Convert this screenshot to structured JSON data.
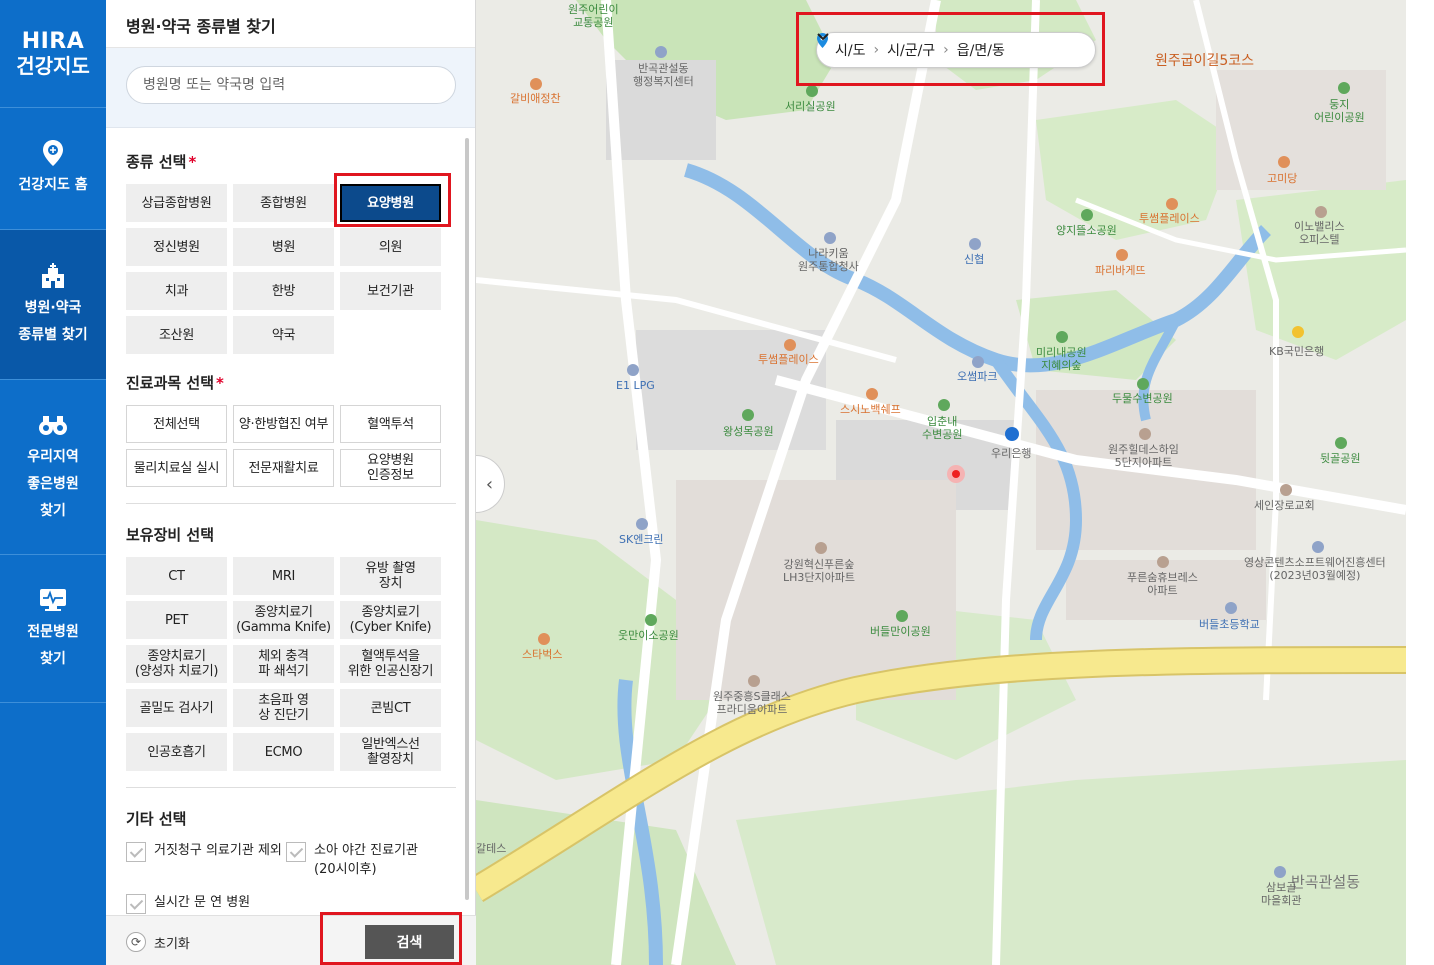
{
  "nav": {
    "logo_line1": "HIRA",
    "logo_line2": "건강지도",
    "items": [
      {
        "label": "건강지도 홈"
      },
      {
        "label": "병원·약국\n종류별 찾기"
      },
      {
        "label": "우리지역\n좋은병원\n찾기"
      },
      {
        "label": "전문병원\n찾기"
      }
    ]
  },
  "panel": {
    "title": "병원·약국 종류별 찾기",
    "search_placeholder": "병원명 또는 약국명 입력"
  },
  "type_section": {
    "title": "종류 선택",
    "required": "*",
    "options": [
      "상급종합병원",
      "종합병원",
      "요양병원",
      "정신병원",
      "병원",
      "의원",
      "치과",
      "한방",
      "보건기관",
      "조산원",
      "약국"
    ],
    "selected": "요양병원"
  },
  "dept_section": {
    "title": "진료과목 선택",
    "required": "*",
    "options": [
      "전체선택",
      "양·한방협진 여부",
      "혈액투석",
      "물리치료실 실시",
      "전문재활치료",
      "요양병원\n인증정보"
    ]
  },
  "equip_section": {
    "title": "보유장비 선택",
    "options": [
      "CT",
      "MRI",
      "유방 촬영\n장치",
      "PET",
      "종양치료기\n(Gamma Knife)",
      "종양치료기\n(Cyber Knife)",
      "종양치료기\n(양성자 치료기)",
      "체외 충격\n파 쇄석기",
      "혈액투석을\n위한 인공신장기",
      "골밀도 검사기",
      "초음파 영\n상 진단기",
      "콘빔CT",
      "인공호흡기",
      "ECMO",
      "일반엑스선\n촬영장치"
    ]
  },
  "etc_section": {
    "title": "기타 선택",
    "options": [
      "거짓청구 의료기관 제외",
      "소아 야간 진료기관\n(20시이후)",
      "실시간 문 연 병원"
    ]
  },
  "footer": {
    "reset_label": "초기화",
    "search_label": "검색"
  },
  "region_bar": {
    "level1": "시/도",
    "level2": "시/군/구",
    "level3": "읍/면/동"
  },
  "map_labels": {
    "l1": "원주어린이\n교통공원",
    "l2": "반곡관설동\n행정복지센터",
    "l3": "갈비애정찬",
    "l4": "서리실공원",
    "l5": "원주굽이길5코스",
    "l6": "둥지\n어린이공원",
    "l7": "고미당",
    "l8": "투썸플레이스",
    "l9": "양지뜰소공원",
    "l10": "이노밸리스\n오피스텔",
    "l11": "나라키움\n원주통합청사",
    "l12": "신협",
    "l13": "파리바게뜨",
    "l14": "KB국민은행",
    "l15": "투썸플레이스",
    "l16": "미리내공원\n지혜의숲",
    "l17": "오썸파크",
    "l18": "E1 LPG",
    "l19": "스시노백쉐프",
    "l20": "두물수변공원",
    "l21": "왕성목공원",
    "l22": "입춘내\n수변공원",
    "l23": "우리은행",
    "l24": "원주힐데스하임\n5단지아파트",
    "l25": "뒷골공원",
    "l26": "세인장로교회",
    "l27": "SK엔크린",
    "l28": "강원혁신푸른숲\nLH3단지아파트",
    "l29": "푸른숨휴브레스\n아파트",
    "l30": "영상콘텐츠소프트웨어진흥센터\n(2023년03월예정)",
    "l31": "버들초등학교",
    "l32": "웃만이소공원",
    "l33": "버들만이공원",
    "l34": "스타벅스",
    "l35": "원주중흥S클래스\n프라디움아파트",
    "l36": "반곡관설동",
    "l37": "삼보골\n마을회관",
    "l38": "갈테스"
  },
  "colors": {
    "nav_bg": "#0d6ec9",
    "selected_bg": "#0c4a8c",
    "highlight": "#e0161f",
    "search_btn": "#555555"
  }
}
